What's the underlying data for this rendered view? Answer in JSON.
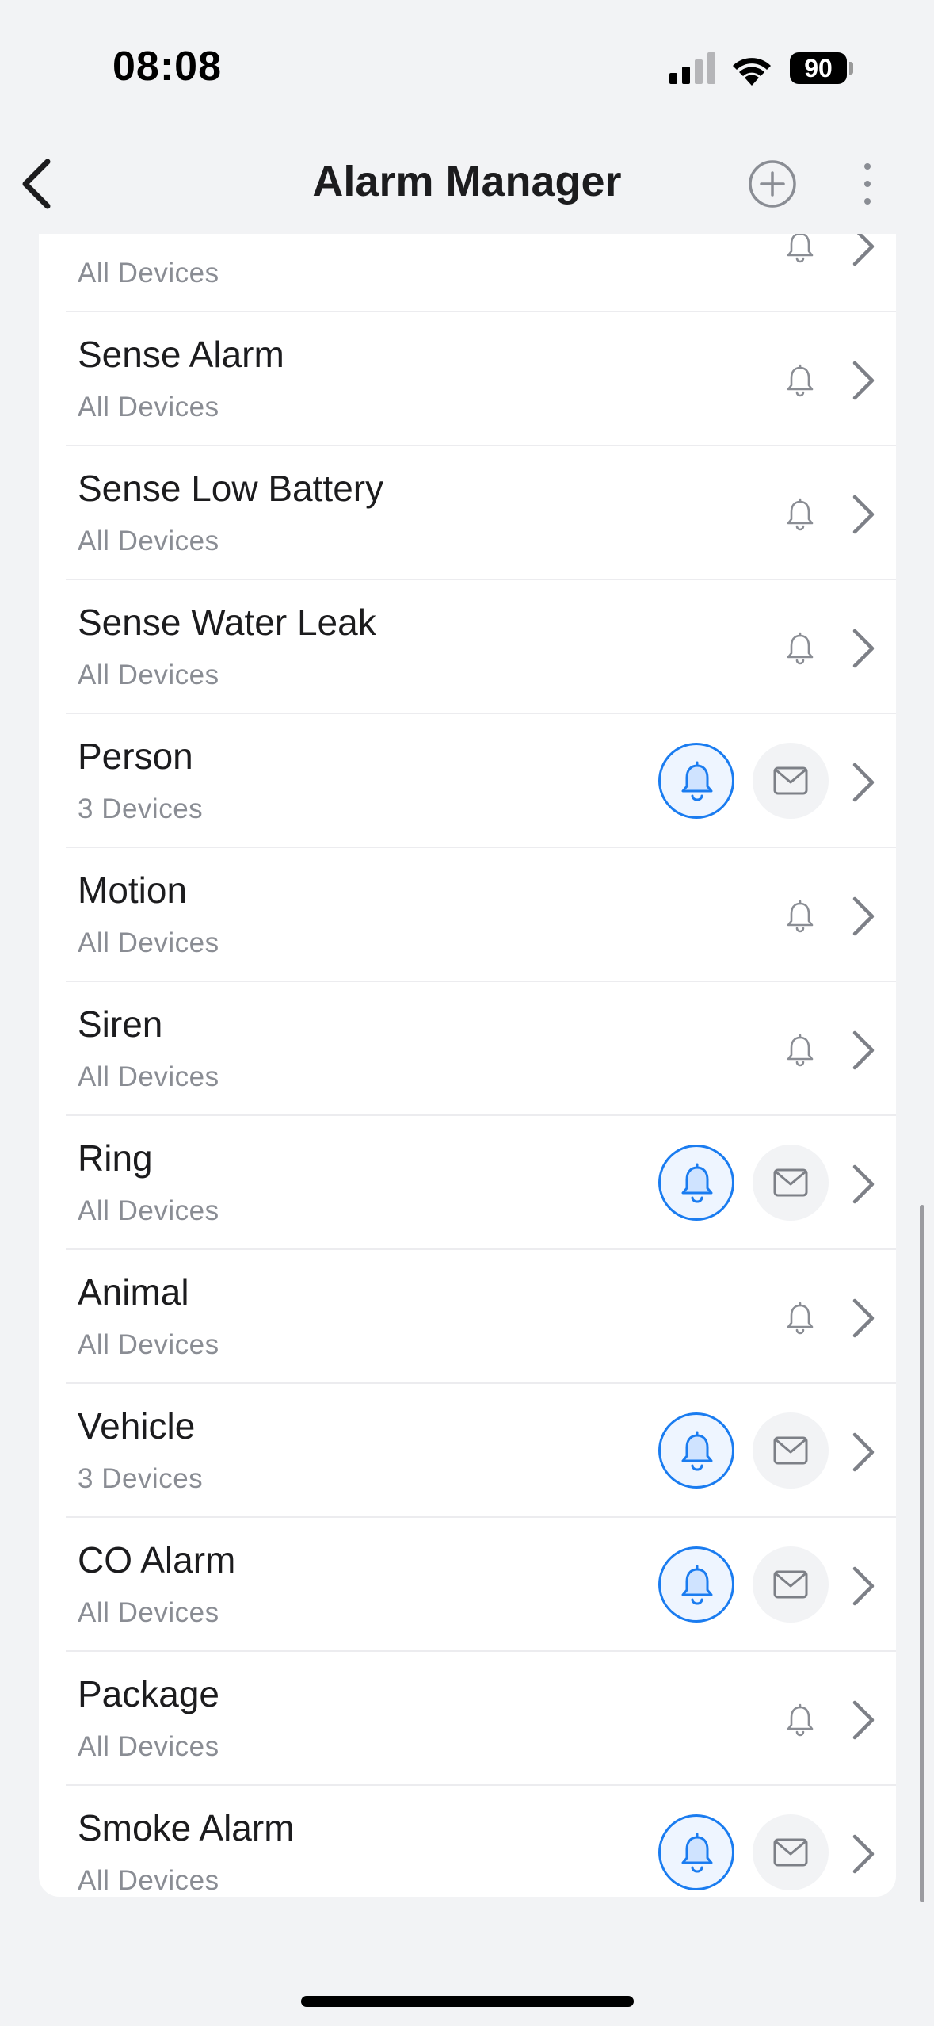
{
  "status_bar": {
    "time": "08:08",
    "battery": "90"
  },
  "nav": {
    "title": "Alarm Manager"
  },
  "alarms": [
    {
      "title": "",
      "subtitle": "All Devices",
      "notify": false
    },
    {
      "title": "Sense Alarm",
      "subtitle": "All Devices",
      "notify": false
    },
    {
      "title": "Sense Low Battery",
      "subtitle": "All Devices",
      "notify": false
    },
    {
      "title": "Sense Water Leak",
      "subtitle": "All Devices",
      "notify": false
    },
    {
      "title": "Person",
      "subtitle": "3 Devices",
      "notify": true
    },
    {
      "title": "Motion",
      "subtitle": "All Devices",
      "notify": false
    },
    {
      "title": "Siren",
      "subtitle": "All Devices",
      "notify": false
    },
    {
      "title": "Ring",
      "subtitle": "All Devices",
      "notify": true
    },
    {
      "title": "Animal",
      "subtitle": "All Devices",
      "notify": false
    },
    {
      "title": "Vehicle",
      "subtitle": "3 Devices",
      "notify": true
    },
    {
      "title": "CO Alarm",
      "subtitle": "All Devices",
      "notify": true
    },
    {
      "title": "Package",
      "subtitle": "All Devices",
      "notify": false
    },
    {
      "title": "Smoke Alarm",
      "subtitle": "All Devices",
      "notify": true
    }
  ],
  "colors": {
    "accent": "#1a7cf0",
    "background": "#f2f3f5",
    "card": "#ffffff",
    "secondary_text": "#8a8d94"
  },
  "icons": {
    "back": "chevron-left-icon",
    "add": "plus-circle-icon",
    "more": "more-vertical-icon",
    "bell": "bell-icon",
    "mail": "mail-icon",
    "chevron": "chevron-right-icon"
  }
}
